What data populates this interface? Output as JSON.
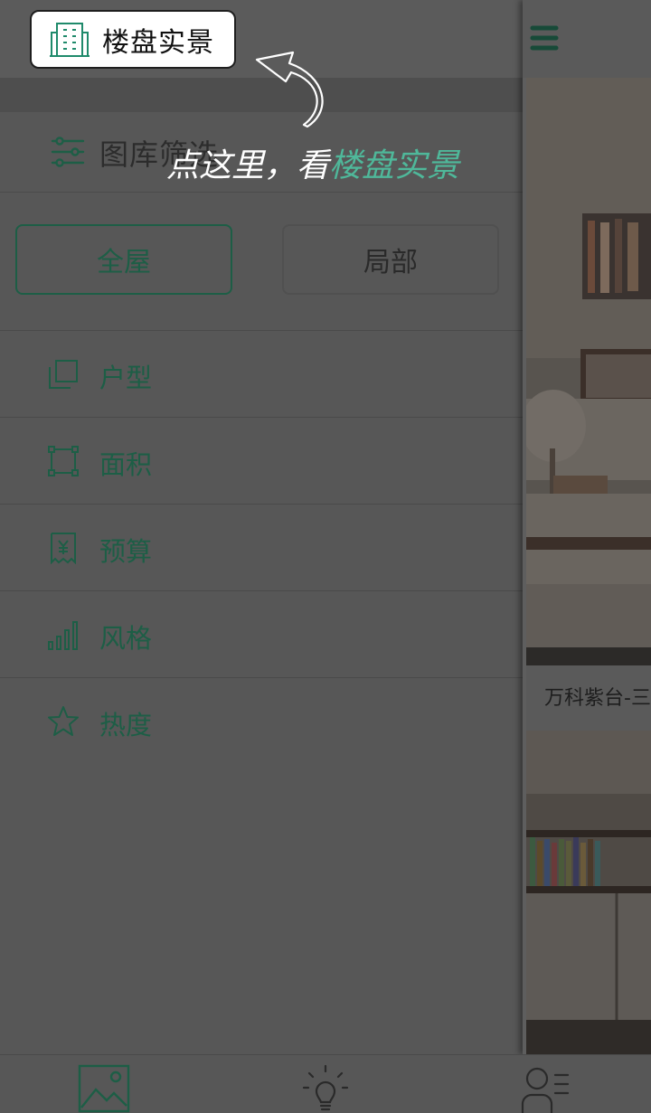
{
  "drawer": {
    "filter_title": "图库筛选",
    "scope_buttons": {
      "active": "全屋",
      "inactive": "局部"
    },
    "items": [
      {
        "label": "户型",
        "icon": "layers-icon"
      },
      {
        "label": "面积",
        "icon": "frame-icon"
      },
      {
        "label": "预算",
        "icon": "receipt-yuan-icon"
      },
      {
        "label": "风格",
        "icon": "bars-icon"
      },
      {
        "label": "热度",
        "icon": "star-icon"
      }
    ]
  },
  "main": {
    "photo_caption": "万科紫台-三"
  },
  "guide": {
    "chip_label": "楼盘实景",
    "text_prefix": "点这里，看",
    "text_highlight": "楼盘实景"
  },
  "tabbar": {
    "tabs": [
      {
        "icon": "gallery-icon"
      },
      {
        "icon": "lightbulb-icon"
      },
      {
        "icon": "user-list-icon"
      }
    ]
  },
  "colors": {
    "accent": "#1d5e46",
    "guide_highlight": "#4fb89a",
    "overlay_bg": "#575757"
  }
}
